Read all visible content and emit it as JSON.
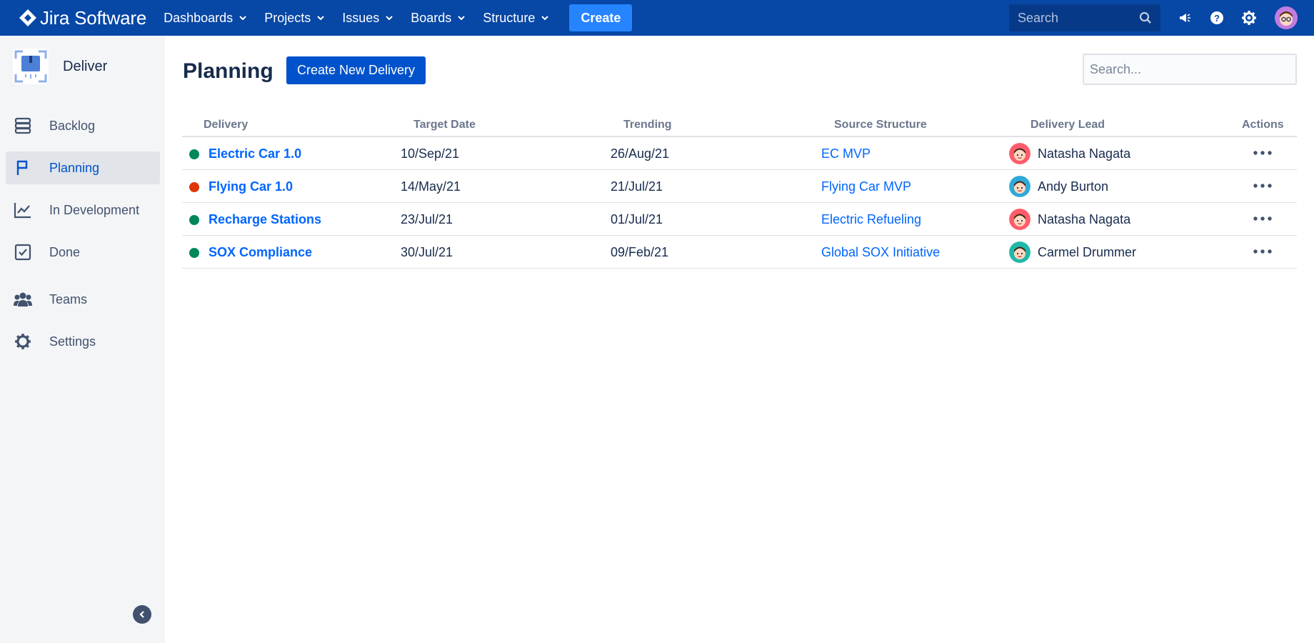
{
  "app": {
    "logo_text": "Jira Software",
    "nav": [
      {
        "label": "Dashboards"
      },
      {
        "label": "Projects"
      },
      {
        "label": "Issues"
      },
      {
        "label": "Boards"
      },
      {
        "label": "Structure"
      }
    ],
    "create_label": "Create",
    "search_placeholder": "Search",
    "icons": [
      "megaphone-icon",
      "help-icon",
      "gear-icon",
      "user-avatar"
    ]
  },
  "sidebar": {
    "project_name": "Deliver",
    "items": [
      {
        "label": "Backlog",
        "icon": "backlog-icon",
        "active": false
      },
      {
        "label": "Planning",
        "icon": "flag-icon",
        "active": true
      },
      {
        "label": "In Development",
        "icon": "chart-line-icon",
        "active": false
      },
      {
        "label": "Done",
        "icon": "checkbox-icon",
        "active": false
      },
      {
        "label": "Teams",
        "icon": "people-icon",
        "active": false
      },
      {
        "label": "Settings",
        "icon": "gear-icon",
        "active": false
      }
    ]
  },
  "main": {
    "title": "Planning",
    "new_button_label": "Create New Delivery",
    "search_placeholder": "Search...",
    "columns": [
      "Delivery",
      "Target Date",
      "Trending",
      "Source Structure",
      "Delivery Lead",
      "Actions"
    ],
    "rows": [
      {
        "status_color": "#00875a",
        "delivery": "Electric Car 1.0",
        "target_date": "10/Sep/21",
        "trending": "26/Aug/21",
        "source": "EC MVP",
        "lead": "Natasha Nagata",
        "avatar_color": "#ff5c6b"
      },
      {
        "status_color": "#de350b",
        "delivery": "Flying Car 1.0",
        "target_date": "14/May/21",
        "trending": "21/Jul/21",
        "source": "Flying Car MVP",
        "lead": "Andy Burton",
        "avatar_color": "#2ea9d9"
      },
      {
        "status_color": "#00875a",
        "delivery": "Recharge Stations",
        "target_date": "23/Jul/21",
        "trending": "01/Jul/21",
        "source": "Electric Refueling",
        "lead": "Natasha Nagata",
        "avatar_color": "#ff5c6b"
      },
      {
        "status_color": "#00875a",
        "delivery": "SOX Compliance",
        "target_date": "30/Jul/21",
        "trending": "09/Feb/21",
        "source": "Global SOX Initiative",
        "lead": "Carmel Drummer",
        "avatar_color": "#20b8a8"
      }
    ]
  }
}
